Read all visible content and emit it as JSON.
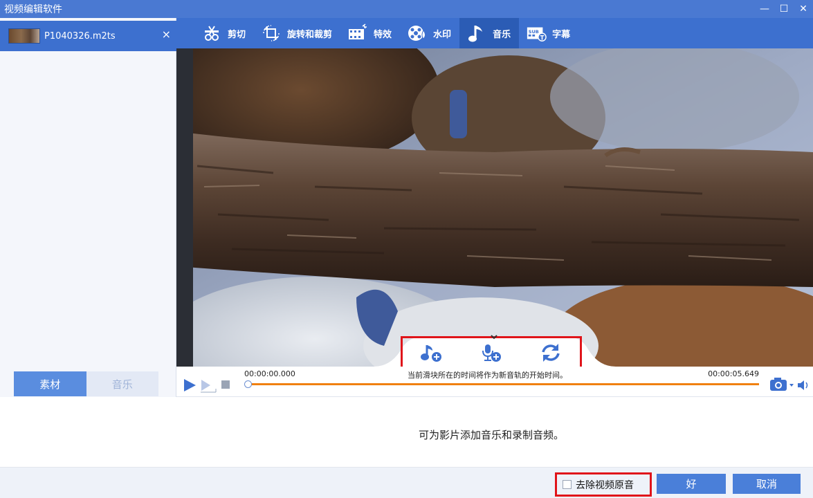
{
  "app": {
    "title": "视频编辑软件"
  },
  "window_controls": {
    "minimize": "—",
    "maximize": "☐",
    "close": "✕"
  },
  "file_list": {
    "items": [
      {
        "name": "P1040326.m2ts",
        "close": "×"
      }
    ]
  },
  "left_tabs": [
    {
      "label": "素材"
    },
    {
      "label": "音乐"
    }
  ],
  "toolbar": {
    "items": [
      {
        "label": "剪切",
        "icon": "cut-icon"
      },
      {
        "label": "旋转和裁剪",
        "icon": "rotate-crop-icon"
      },
      {
        "label": "特效",
        "icon": "effects-icon"
      },
      {
        "label": "水印",
        "icon": "watermark-icon"
      },
      {
        "label": "音乐",
        "icon": "music-icon",
        "active": true
      },
      {
        "label": "字幕",
        "icon": "subtitle-icon"
      }
    ]
  },
  "audio_tools": [
    {
      "icon": "add-music-icon"
    },
    {
      "icon": "record-audio-icon"
    },
    {
      "icon": "refresh-icon"
    }
  ],
  "playback": {
    "current_time": "00:00:00.000",
    "total_time": "00:00:05.649",
    "hint": "当前滑块所在的时间将作为新音轨的开始时间。",
    "progress": 0
  },
  "info": {
    "message": "可为影片添加音乐和录制音频。"
  },
  "footer": {
    "remove_original_audio": "去除视频原音",
    "remove_original_checked": false,
    "ok": "好",
    "cancel": "取消"
  },
  "colors": {
    "accent": "#3d70cf",
    "highlight_red": "#e0141a",
    "progress_orange": "#f08010"
  }
}
